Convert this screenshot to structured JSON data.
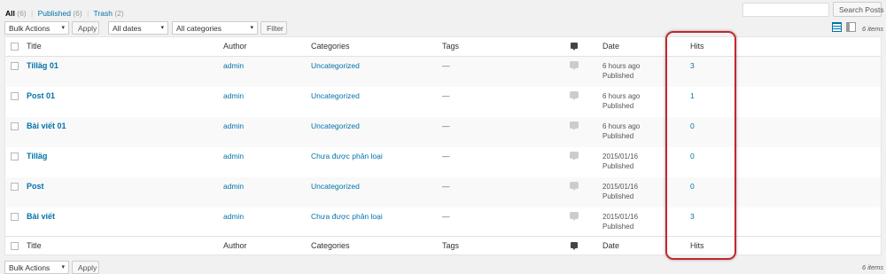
{
  "subsubsub": {
    "all_label": "All",
    "all_count": "(6)",
    "published_label": "Published",
    "published_count": "(6)",
    "trash_label": "Trash",
    "trash_count": "(2)",
    "sep": "|"
  },
  "filters": {
    "bulk_actions": "Bulk Actions",
    "apply": "Apply",
    "dates": "All dates",
    "categories": "All categories",
    "filter": "Filter"
  },
  "search": {
    "button": "Search Posts",
    "value": ""
  },
  "items_count": "6 items",
  "columns": {
    "title": "Title",
    "author": "Author",
    "categories": "Categories",
    "tags": "Tags",
    "date": "Date",
    "hits": "Hits"
  },
  "rows": [
    {
      "title": "Tilläg 01",
      "author": "admin",
      "category": "Uncategorized",
      "tags": "—",
      "date": "6 hours ago",
      "status": "Published",
      "hits": "3"
    },
    {
      "title": "Post 01",
      "author": "admin",
      "category": "Uncategorized",
      "tags": "—",
      "date": "6 hours ago",
      "status": "Published",
      "hits": "1"
    },
    {
      "title": "Bài viết 01",
      "author": "admin",
      "category": "Uncategorized",
      "tags": "—",
      "date": "6 hours ago",
      "status": "Published",
      "hits": "0"
    },
    {
      "title": "Tilläg",
      "author": "admin",
      "category": "Chưa được phân loại",
      "tags": "—",
      "date": "2015/01/16",
      "status": "Published",
      "hits": "0"
    },
    {
      "title": "Post",
      "author": "admin",
      "category": "Uncategorized",
      "tags": "—",
      "date": "2015/01/16",
      "status": "Published",
      "hits": "0"
    },
    {
      "title": "Bài viết",
      "author": "admin",
      "category": "Chưa được phân loại",
      "tags": "—",
      "date": "2015/01/16",
      "status": "Published",
      "hits": "3"
    }
  ],
  "bottom": {
    "bulk_actions": "Bulk Actions",
    "apply": "Apply",
    "items_count": "6 items"
  },
  "icons": {
    "dropdown": "▾",
    "comments": "comment-bubble-icon",
    "list_view": "list-view-icon",
    "excerpt_view": "excerpt-view-icon"
  },
  "colors": {
    "link": "#0073aa",
    "highlight": "#c1272d"
  }
}
